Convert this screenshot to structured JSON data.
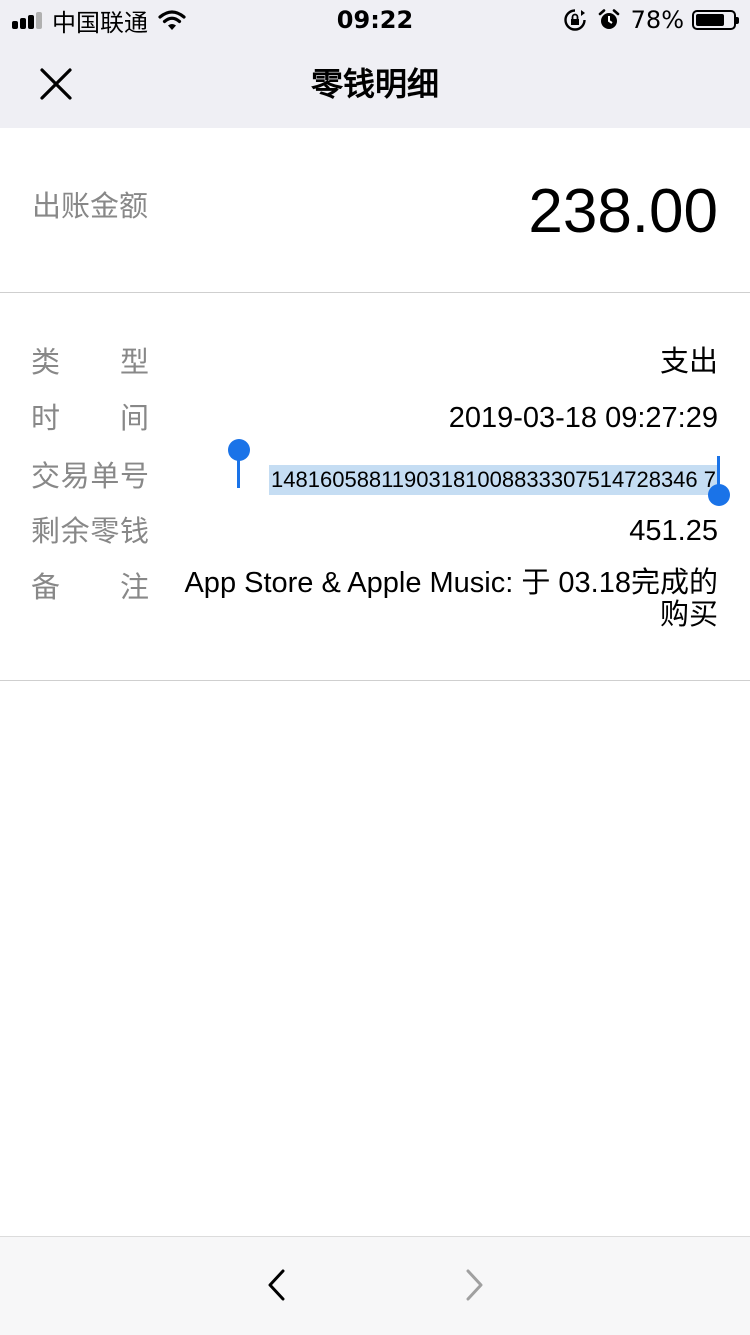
{
  "status_bar": {
    "carrier": "中国联通",
    "time": "09:22",
    "battery": "78%",
    "battery_level": 0.78,
    "icons": [
      "signal-icon",
      "wifi-icon",
      "rotation-lock-icon",
      "alarm-icon",
      "battery-icon"
    ]
  },
  "nav": {
    "title": "零钱明细",
    "close_icon": "close-icon"
  },
  "amount": {
    "label": "出账金额",
    "value": "238.00"
  },
  "details": [
    {
      "label": "类型",
      "value": "支出"
    },
    {
      "label": "时间",
      "value": "2019-03-18 09:27:29"
    },
    {
      "label": "交易单号",
      "value": "1481605881190318100883330751472834 67"
    },
    {
      "label": "剩余零钱",
      "value": "451.25"
    },
    {
      "label": "备注",
      "value": "App Store & Apple Music: 于 03.18完成的购买"
    }
  ],
  "selection": {
    "selected_text": "14816058811903181008833307514728346 7"
  },
  "toolbar": {
    "back_icon": "chevron-left-icon",
    "forward_icon": "chevron-right-icon",
    "accent_color": "#1a73e8"
  }
}
